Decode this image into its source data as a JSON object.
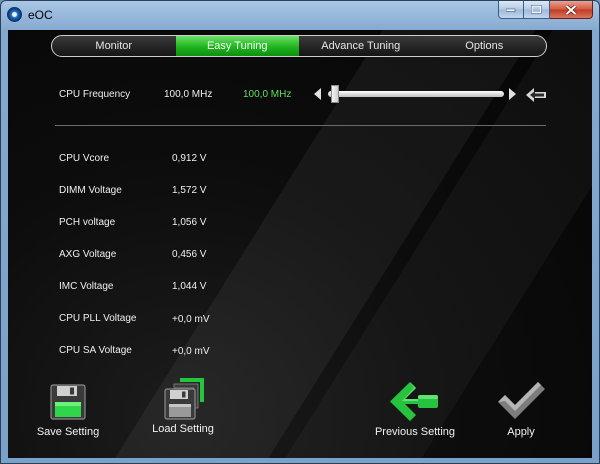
{
  "window": {
    "title": "eOC"
  },
  "tabs": [
    {
      "label": "Monitor",
      "active": false
    },
    {
      "label": "Easy Tuning",
      "active": true
    },
    {
      "label": "Advance Tuning",
      "active": false
    },
    {
      "label": "Options",
      "active": false
    }
  ],
  "cpu_frequency": {
    "label": "CPU Frequency",
    "current": "100,0 MHz",
    "target": "100,0 MHz"
  },
  "voltages": [
    {
      "label": "CPU Vcore",
      "value": "0,912 V"
    },
    {
      "label": "DIMM Voltage",
      "value": "1,572 V"
    },
    {
      "label": "PCH voltage",
      "value": "1,056 V"
    },
    {
      "label": "AXG Voltage",
      "value": "0,456 V"
    },
    {
      "label": "IMC Voltage",
      "value": "1,044 V"
    },
    {
      "label": "CPU PLL Voltage",
      "value": "+0,0 mV"
    },
    {
      "label": "CPU SA Voltage",
      "value": "+0,0 mV"
    }
  ],
  "actions": {
    "save": "Save Setting",
    "load": "Load Setting",
    "previous": "Previous Setting",
    "apply": "Apply"
  },
  "icons": {
    "app": "eoc-app-icon",
    "save": "floppy-disk-icon",
    "load": "floppy-disk-load-icon",
    "previous": "green-left-arrow-icon",
    "apply": "checkmark-icon",
    "reset": "reset-arrow-icon"
  },
  "colors": {
    "accent": "#1eb51e",
    "value_green": "#5fe05a",
    "background": "#0b0b0b"
  }
}
